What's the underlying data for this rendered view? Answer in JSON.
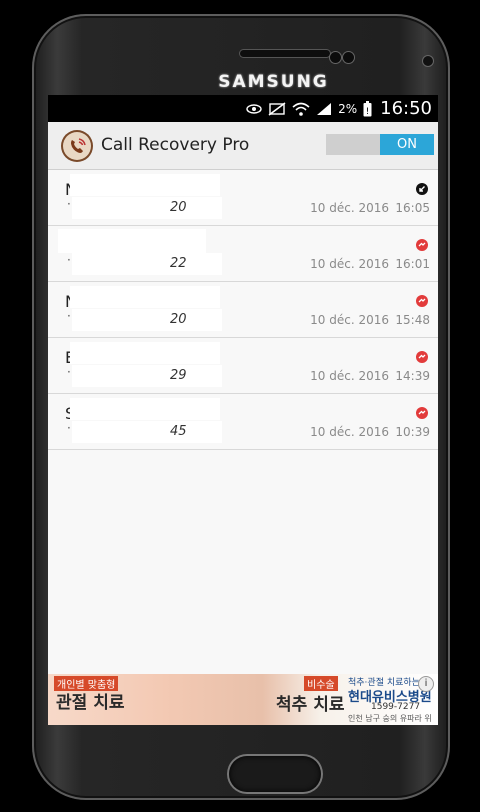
{
  "device": {
    "brand": "SAMSUNG"
  },
  "status_bar": {
    "battery_percent": "2%",
    "time": "16:50",
    "icons": [
      "eye-icon",
      "no-sync-icon",
      "wifi-icon",
      "signal-icon",
      "battery-alert-icon"
    ]
  },
  "app": {
    "title": "Call Recovery Pro",
    "toggle_label": "ON",
    "accent": "#2ca6d8"
  },
  "calls": [
    {
      "name_fragment": "N",
      "name_fragment2": "l",
      "number_fragment": "20",
      "date": "10 déc. 2016",
      "time": "16:05",
      "call_type": "incoming-call-icon"
    },
    {
      "name_fragment": "",
      "name_fragment2": "",
      "number_fragment": "22",
      "date": "10 déc. 2016",
      "time": "16:01",
      "call_type": "missed-call-icon"
    },
    {
      "name_fragment": "N",
      "name_fragment2": "l",
      "number_fragment": "20",
      "date": "10 déc. 2016",
      "time": "15:48",
      "call_type": "missed-call-icon"
    },
    {
      "name_fragment": "E",
      "name_fragment2": "",
      "number_fragment": "29",
      "date": "10 déc. 2016",
      "time": "14:39",
      "call_type": "missed-call-icon"
    },
    {
      "name_fragment": "S",
      "name_fragment2": "",
      "number_fragment": "45",
      "date": "10 déc. 2016",
      "time": "10:39",
      "call_type": "missed-call-icon"
    }
  ],
  "ad": {
    "left_badge": "개인별 맞춤형",
    "left_title": "관절 치료",
    "mid_badge": "비수술",
    "mid_title": "척추 치료",
    "right_top": "척추·관절 치료하는",
    "right_title": "현대유비스병원",
    "right_phone": "1599-7277",
    "right_bottom": "인천 남구 숭의 유파라 위치"
  }
}
